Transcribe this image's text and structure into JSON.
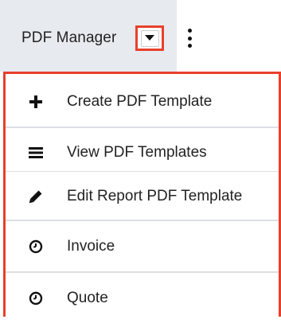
{
  "module_bar": {
    "module_name": "PDF Manager",
    "caret_icon": "caret-down-icon",
    "more_icon": "kebab-vertical-icon"
  },
  "highlight_color": "#e8402c",
  "menu": {
    "items": [
      {
        "label": "Create PDF Template",
        "icon": "plus-icon"
      },
      {
        "label": "View PDF Templates",
        "icon": "list-icon"
      },
      {
        "label": "Edit Report PDF Template",
        "icon": "pencil-icon"
      },
      {
        "label": "Invoice",
        "icon": "clock-icon"
      },
      {
        "label": "Quote",
        "icon": "clock-icon"
      }
    ]
  }
}
